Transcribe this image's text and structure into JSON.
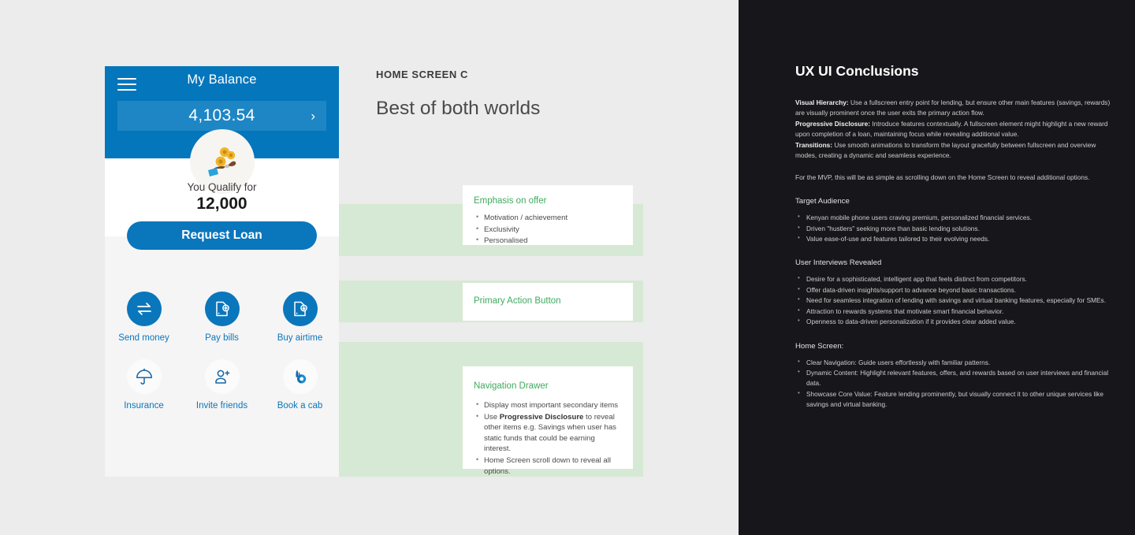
{
  "canvas": {
    "kicker": "HOME SCREEN C",
    "headline": "Best of both worlds"
  },
  "phone": {
    "header": {
      "menu_icon": "hamburger-menu-icon",
      "title": "My Balance",
      "balance_amount": "4,103.54",
      "chevron_icon": "chevron-right-icon",
      "header_color": "#0376BC",
      "pill_color": "#1E86C4"
    },
    "offer": {
      "illustration": "hand-with-coins-icon",
      "qualify_label": "You Qualify for",
      "qualify_amount": "12,000",
      "cta_label": "Request Loan",
      "cta_color": "#0A76BC"
    },
    "shortcuts": [
      {
        "label": "Send money",
        "icon": "transfer-arrows-icon",
        "style": "filled"
      },
      {
        "label": "Pay bills",
        "icon": "bill-document-icon",
        "style": "filled"
      },
      {
        "label": "Buy airtime",
        "icon": "airtime-download-icon",
        "style": "filled"
      },
      {
        "label": "Insurance",
        "icon": "umbrella-icon",
        "style": "plain"
      },
      {
        "label": "Invite friends",
        "icon": "person-plus-icon",
        "style": "plain"
      },
      {
        "label": "Book a cab",
        "icon": "bolt-ride-icon",
        "style": "plain"
      }
    ]
  },
  "annotations": [
    {
      "title": "Emphasis on offer",
      "items": [
        "Motivation / achievement",
        "Exclusivity",
        "Personalised"
      ]
    },
    {
      "title": "Primary Action Button",
      "items": []
    },
    {
      "title": "Navigation Drawer",
      "items": [
        "Display most important secondary items",
        "Use <b>Progressive Disclosure</b> to reveal other items e.g. Savings when user has static funds that could be earning interest.",
        "Home Screen scroll down to reveal all options."
      ]
    }
  ],
  "conclusions": {
    "title": "UX UI Conclusions",
    "intro_html": "<b>Visual Hierarchy:</b> Use a  fullscreen entry point for lending, but ensure other main features  (savings, rewards) are visually prominent once the user exits the  primary action flow.<br><b>Progressive Disclosure:</b>  Introduce features contextually. A fullscreen element might highlight a  new reward upon completion of a loan, maintaining focus while revealing  additional value.<br><b>Transitions:</b> Use smooth  animations to transform the layout gracefully between fullscreen and overview modes, creating a dynamic and seamless experience.",
    "mvp_note": "For the MVP, this will be as simple as scrolling down on the Home Screen to reveal additional options.",
    "sections": [
      {
        "heading": "Target Audience",
        "items": [
          "Kenyan mobile phone users craving premium, personalized financial services.",
          "Driven \"hustlers\" seeking more than basic lending solutions.",
          "Value ease-of-use and features tailored to their evolving needs."
        ]
      },
      {
        "heading": "User Interviews Revealed",
        "items": [
          "Desire for a sophisticated, intelligent app that feels distinct from competitors.",
          "Offer data-driven insights/support to advance beyond basic transactions.",
          "Need for seamless integration of lending with savings and virtual banking features, especially for SMEs.",
          "Attraction to rewards systems that motivate smart financial behavior.",
          "Openness to data-driven personalization if it provides clear added value."
        ]
      },
      {
        "heading": "Home Screen:",
        "items": [
          "Clear Navigation: Guide users effortlessly with familiar patterns.",
          "Dynamic Content:  Highlight relevant features, offers, and rewards based on user interviews and financial data.",
          "Showcase Core Value: Feature lending prominently, but visually connect it to other unique services like savings and virtual banking."
        ]
      }
    ]
  }
}
